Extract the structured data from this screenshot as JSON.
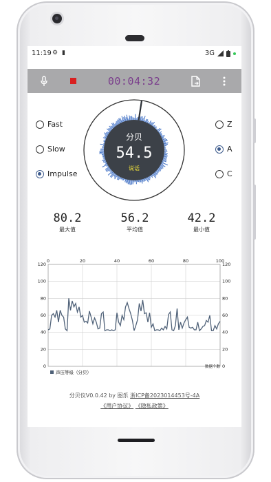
{
  "status": {
    "time": "11:19",
    "network": "3G"
  },
  "toolbar": {
    "timer": "00:04:32"
  },
  "speed": {
    "options": [
      {
        "label": "Fast"
      },
      {
        "label": "Slow"
      },
      {
        "label": "Impulse"
      }
    ],
    "selected": "Impulse"
  },
  "weighting": {
    "options": [
      {
        "label": "Z"
      },
      {
        "label": "A"
      },
      {
        "label": "C"
      }
    ],
    "selected": "A"
  },
  "gauge": {
    "unit": "分贝",
    "value": "54.5",
    "level": 54.5,
    "description": "说话"
  },
  "stats": {
    "max": {
      "value": "80.2",
      "label": "最大值"
    },
    "avg": {
      "value": "56.2",
      "label": "平均值"
    },
    "min": {
      "value": "42.2",
      "label": "最小值"
    }
  },
  "chart_data": {
    "type": "line",
    "x_top_ticks": [
      "0",
      "20",
      "40",
      "60",
      "80",
      "100"
    ],
    "y_ticks": [
      "0",
      "20",
      "40",
      "60",
      "80",
      "100",
      "120"
    ],
    "xlim": [
      0,
      100
    ],
    "ylim": [
      0,
      120
    ],
    "xlabel": "数据个数",
    "legend": "声压等级（分贝）",
    "series": [
      {
        "name": "声压等级（分贝）",
        "color": "#4f6178",
        "x": [
          0,
          1,
          2,
          3,
          4,
          5,
          6,
          7,
          8,
          9,
          10,
          11,
          12,
          13,
          14,
          15,
          16,
          17,
          18,
          19,
          20,
          21,
          22,
          23,
          24,
          25,
          26,
          27,
          28,
          29,
          30,
          31,
          32,
          33,
          34,
          35,
          36,
          37,
          38,
          39,
          40,
          41,
          42,
          43,
          44,
          45,
          46,
          47,
          48,
          49,
          50,
          51,
          52,
          53,
          54,
          55,
          56,
          57,
          58,
          59,
          60,
          61,
          62,
          63,
          64,
          65,
          66,
          67,
          68,
          69,
          70,
          71,
          72,
          73,
          74,
          75,
          76,
          77,
          78,
          79,
          80,
          81,
          82,
          83,
          84,
          85,
          86,
          87,
          88,
          89,
          90,
          91,
          92,
          93,
          94,
          95,
          96,
          97,
          98,
          99,
          100
        ],
        "y": [
          43,
          44,
          60,
          62,
          58,
          66,
          52,
          66,
          60,
          58,
          44,
          42,
          80,
          66,
          77,
          70,
          74,
          64,
          70,
          58,
          60,
          52,
          53,
          51,
          65,
          58,
          50,
          57,
          52,
          44,
          45,
          62,
          64,
          42,
          43,
          43,
          42,
          43,
          42,
          43,
          63,
          52,
          48,
          60,
          55,
          70,
          75,
          68,
          62,
          54,
          42,
          48,
          55,
          74,
          65,
          78,
          62,
          63,
          52,
          63,
          46,
          50,
          42,
          43,
          43,
          42,
          45,
          43,
          47,
          44,
          61,
          64,
          43,
          42,
          48,
          68,
          43,
          52,
          45,
          51,
          55,
          58,
          46,
          45,
          46,
          43,
          43,
          52,
          42,
          44,
          47,
          48,
          54,
          52,
          60,
          42,
          42,
          48,
          44,
          50,
          53
        ]
      }
    ],
    "grid": true
  },
  "footer": {
    "app_version": "分贝仪V0.0.42 by 图乐",
    "icp": "浙ICP备2023014453号-4A",
    "user_agreement": "《用户协议》",
    "privacy_policy": "《隐私政策》"
  }
}
